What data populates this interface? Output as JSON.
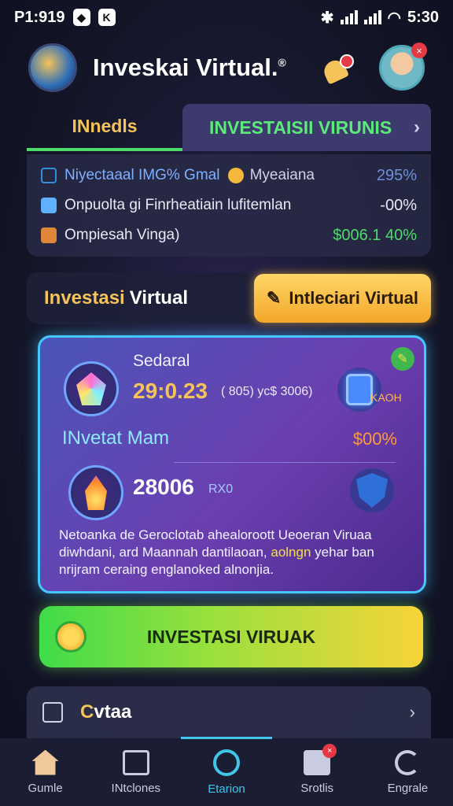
{
  "status_bar": {
    "time_left": "P1:919",
    "time_right": "5:30"
  },
  "header": {
    "title": "Inveskai Virtual.",
    "title_mark": "®",
    "notification_badge": "",
    "avatar_badge": "×"
  },
  "tabs": [
    {
      "label": "INnedls"
    },
    {
      "label": "INVESTAISII VIRUNIS",
      "chevron": "›"
    }
  ],
  "stats": [
    {
      "label": "Niyectaaal IMG% Gmal",
      "mid": "Myeaiana",
      "value": "295%",
      "value_color": "#6f8fd8",
      "icon_color": "#2f8fd8",
      "mid_icon": true
    },
    {
      "label": "Onpuolta gi Finrheatiain lufitemlan",
      "mid": "",
      "value": "-00%",
      "value_color": "#e8eaf5",
      "icon_color": "#5fb0ff"
    },
    {
      "label": "Ompiesah Vinga)",
      "mid": "",
      "value": "$006.1 40%",
      "value_color": "#4ddb6a",
      "icon_color": "#e0863a"
    }
  ],
  "section": {
    "title_highlight": "Investasi",
    "title_rest": "Virtual",
    "action_label": "Intleciari Virtual",
    "action_icon": "✎"
  },
  "card": {
    "row1_label": "Sedaral",
    "row1_value": "29:0.23",
    "row1_sub": "( 805)  yc$ 3006)",
    "row1_tag": "KAOH",
    "mid_label": "INvetat Mam",
    "mid_value": "$00%",
    "row2_value": "28006",
    "row2_unit": "RX0",
    "desc_line1": "Netoanka de Geroclotab ahealoroott Ueoeran Viruaa",
    "desc_line2": "diwhdani, ard Maannah dantilaoan,",
    "desc_highlight": "aolngn",
    "desc_line2b": "yehar ban",
    "desc_line3": "nrijram ceraing englanoked alnonjia.",
    "corner_icon": "✎"
  },
  "cta": {
    "label": "INVESTASI VIRUAK"
  },
  "list": {
    "label_first": "C",
    "label_rest": "vtaa",
    "chevron": "›"
  },
  "nav": [
    {
      "label": "Gumle",
      "icon": "home-icon"
    },
    {
      "label": "INtclones",
      "icon": "box-icon"
    },
    {
      "label": "Etarion",
      "icon": "target-icon",
      "active": true
    },
    {
      "label": "Srotlis",
      "icon": "document-icon",
      "badge": "×"
    },
    {
      "label": "Engrale",
      "icon": "refresh-icon"
    }
  ]
}
